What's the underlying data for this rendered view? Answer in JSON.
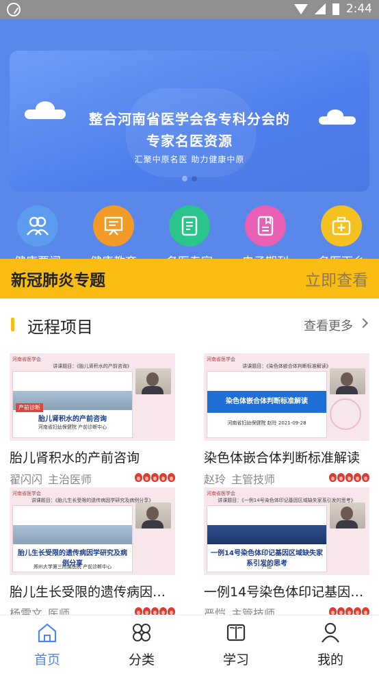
{
  "status_bar": {
    "time": "2:44"
  },
  "banner": {
    "title_line1": "整合河南省医学会各专科分会的",
    "title_line2": "专家名医资源",
    "subtitle": "汇聚中原名医  助力健康中原"
  },
  "categories": [
    {
      "label": "健康要闻",
      "icon": "people-icon",
      "color": "#5b9cf0"
    },
    {
      "label": "健康教育",
      "icon": "monitor-icon",
      "color": "#f39a27"
    },
    {
      "label": "名医专家",
      "icon": "document-icon",
      "color": "#2bc48b"
    },
    {
      "label": "电子期刊",
      "icon": "journal-icon",
      "color": "#e85fb4"
    },
    {
      "label": "名医下乡",
      "icon": "medical-kit-icon",
      "color": "#f4c120"
    }
  ],
  "covid_bar": {
    "title": "新冠肺炎专题",
    "link": "立即查看"
  },
  "section": {
    "title": "远程项目",
    "more": "查看更多"
  },
  "cards": [
    {
      "title": "胎儿肾积水的产前咨询",
      "author": "翟闪闪",
      "role": "主治医师",
      "thumb_header": "河南省医学会",
      "thumb_topic": "讲课题目：《胎儿肾积水的产前咨询》",
      "slide_title": "胎儿肾积水的产前咨询",
      "slide_sub": "河南省妇幼保健院 产前诊断中心",
      "badge": "产前诊断"
    },
    {
      "title": "染色体嵌合体判断标准解读",
      "author": "赵玲",
      "role": "主管技师",
      "thumb_header": "河南省医学会",
      "thumb_topic": "讲课题目：《染色体嵌合体判断标准解读》",
      "slide_title": "染色体嵌合体判断标准解读",
      "slide_sub": "河南省妇幼保健院  赵玲  2021-09-28"
    },
    {
      "title": "胎儿生长受限的遗传病因学研究及病例分享",
      "author": "杨雪文",
      "role": "医师",
      "thumb_header": "河南省医学会",
      "thumb_topic": "讲课题目：《胎儿生长受限的遗传病因学研究及病例分享》",
      "slide_title": "胎儿生长受限的遗传病因学研究及病例分享",
      "slide_sub": "郑州大学第三附属医院 产前诊断中心"
    },
    {
      "title": "一例14号染色体印记基因区域缺失家系引发的思考",
      "author": "严恺",
      "role": "主管技师",
      "thumb_header": "河南省医学会",
      "thumb_topic": "讲课题目：《一例14号染色体印记基因区域缺失家系引发的思考》",
      "slide_title": "一例14号染色体印记基因区域缺失家系引发的思考",
      "slide_sub": "严恺"
    }
  ],
  "tabbar": [
    {
      "label": "首页",
      "icon": "home-icon",
      "active": true
    },
    {
      "label": "分类",
      "icon": "grid-icon",
      "active": false
    },
    {
      "label": "学习",
      "icon": "book-icon",
      "active": false
    },
    {
      "label": "我的",
      "icon": "user-icon",
      "active": false
    }
  ]
}
